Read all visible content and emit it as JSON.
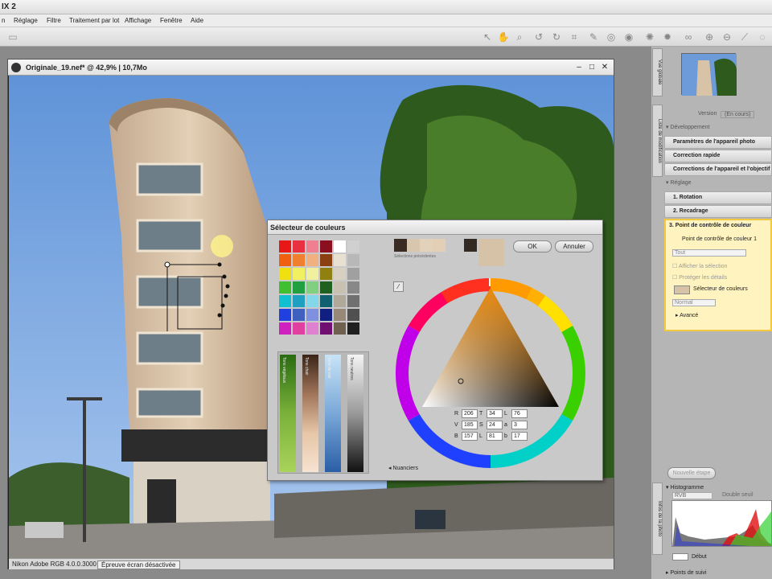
{
  "app": {
    "title": "IX 2"
  },
  "menu": [
    "n",
    "Réglage",
    "Filtre",
    "Traitement par lot",
    "Affichage",
    "Fenêtre",
    "Aide"
  ],
  "image_window": {
    "title": "Originale_19.nef* @ 42,9% | 10,7Mo",
    "status_profile": "Nikon Adobe RGB 4.0.0.3000",
    "status_softproof": "Épreuve écran désactivée"
  },
  "color_dialog": {
    "title": "Sélecteur de couleurs",
    "recent_label": "Sélections précédentes",
    "ok_label": "OK",
    "cancel_label": "Annuler",
    "gradient_labels": [
      "Tons végétaux",
      "Tons chair",
      "Tons de ciel",
      "Tons neutres"
    ],
    "nuances_label": "Nuanciers",
    "fields": {
      "R": "206",
      "V": "185",
      "B": "157",
      "T": "34",
      "S": "24",
      "L1": "81",
      "L2": "76",
      "a": "3",
      "b": "17"
    },
    "current_color": "#d6c2a6",
    "recent_colors": [
      "#3a2c24",
      "#d8c6ae",
      "#e2d1bb",
      "#e3cfb5",
      "#332a24"
    ]
  },
  "right_panel": {
    "tab_overview": "Vue globale",
    "tab_edit_list": "Liste de modification",
    "version_label": "Version",
    "version_value": "(En cours)",
    "section_develop": "Développement",
    "camera_settings": "Paramètres de l'appareil photo",
    "quick_fix": "Correction rapide",
    "camera_lens_corrections": "Corrections de l'appareil et l'objectif",
    "section_adjust": "Réglage",
    "step1": "1. Rotation",
    "step2": "2. Recadrage",
    "step3": "3. Point de contrôle de couleur",
    "ccp_name": "Point de contrôle de couleur 1",
    "mode_value": "Tout",
    "show_selection": "Afficher la sélection",
    "protect_details": "Protéger les détails",
    "color_picker_label": "Sélecteur de couleurs",
    "blend_value": "Normal",
    "advanced": "Avancé",
    "new_step": "Nouvelle étape",
    "tab_photo_info": "Infos de la photo",
    "histogram_label": "Histogramme",
    "channel_value": "RVB",
    "threshold_label": "Double seuil",
    "start_label": "Début",
    "focus_points": "Points de suivi"
  },
  "colors": {
    "accent": "#f5c842",
    "panel": "#b5b5b5",
    "highlight": "#fff4c0"
  }
}
